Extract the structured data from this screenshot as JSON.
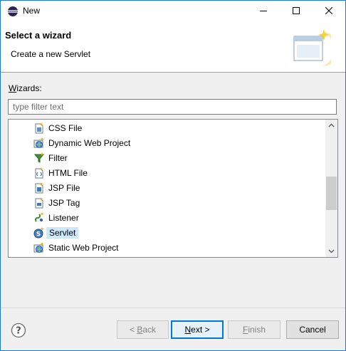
{
  "window": {
    "title": "New"
  },
  "header": {
    "title": "Select a wizard",
    "description": "Create a new Servlet"
  },
  "wizards": {
    "label_prefix": "W",
    "label_rest": "izards:",
    "filter_placeholder": "type filter text",
    "items": [
      {
        "label": "CSS File",
        "icon": "css-file-icon",
        "selected": false
      },
      {
        "label": "Dynamic Web Project",
        "icon": "web-project-icon",
        "selected": false
      },
      {
        "label": "Filter",
        "icon": "filter-icon",
        "selected": false
      },
      {
        "label": "HTML File",
        "icon": "html-file-icon",
        "selected": false
      },
      {
        "label": "JSP File",
        "icon": "jsp-file-icon",
        "selected": false
      },
      {
        "label": "JSP Tag",
        "icon": "jsp-tag-icon",
        "selected": false
      },
      {
        "label": "Listener",
        "icon": "listener-icon",
        "selected": false
      },
      {
        "label": "Servlet",
        "icon": "servlet-icon",
        "selected": true
      },
      {
        "label": "Static Web Project",
        "icon": "web-project-icon",
        "selected": false
      }
    ]
  },
  "buttons": {
    "back_prefix": "< ",
    "back_key": "B",
    "back_rest": "ack",
    "next_key": "N",
    "next_rest": "ext >",
    "finish_key": "F",
    "finish_rest": "inish",
    "cancel": "Cancel"
  },
  "colors": {
    "selection": "#cce8ff",
    "default_button_border": "#0078d7",
    "window_border": "#1e78d7"
  }
}
